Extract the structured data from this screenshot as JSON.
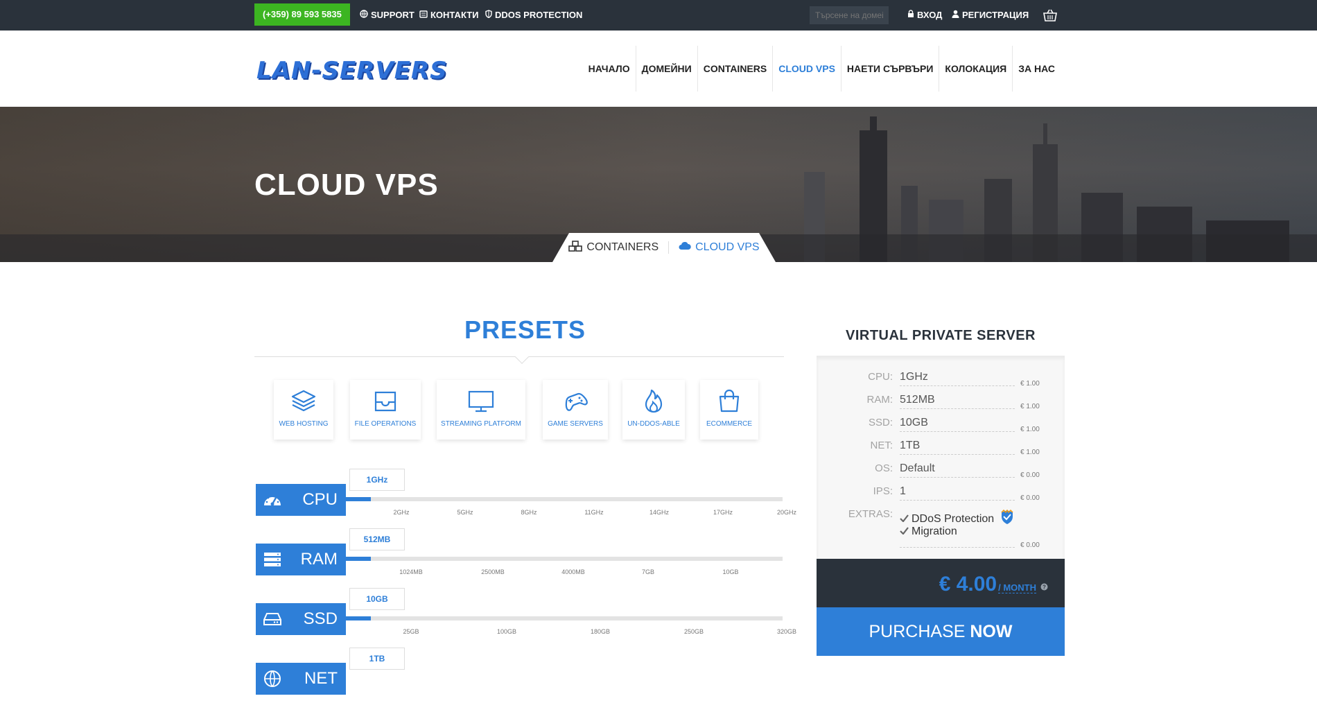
{
  "topbar": {
    "phone": "(+359) 89 593 5835",
    "links": [
      {
        "label": "SUPPORT",
        "icon": "globe-icon"
      },
      {
        "label": "КОНТАКТИ",
        "icon": "contact-icon"
      },
      {
        "label": "DDOS PROTECTION",
        "icon": "shield-icon"
      }
    ],
    "search_placeholder": "Търсене на домейн",
    "login": "ВХОД",
    "register": "РЕГИСТРАЦИЯ",
    "cart_icon": "basket-icon"
  },
  "logo": "LAN-SERVERS",
  "nav": [
    {
      "label": "НАЧАЛО",
      "active": false
    },
    {
      "label": "ДОМЕЙНИ",
      "active": false
    },
    {
      "label": "CONTAINERS",
      "active": false
    },
    {
      "label": "CLOUD VPS",
      "active": true
    },
    {
      "label": "НАЕТИ СЪРВЪРИ",
      "active": false
    },
    {
      "label": "КОЛОКАЦИЯ",
      "active": false
    },
    {
      "label": "ЗА НАС",
      "active": false
    }
  ],
  "hero": {
    "title": "CLOUD VPS",
    "tabs": [
      {
        "label": "CONTAINERS",
        "icon": "cubes-icon",
        "active": false
      },
      {
        "label": "CLOUD VPS",
        "icon": "cloud-icon",
        "active": true
      }
    ]
  },
  "presets": {
    "title": "PRESETS",
    "items": [
      {
        "label": "WEB HOSTING",
        "icon": "layers-icon"
      },
      {
        "label": "FILE OPERATIONS",
        "icon": "inbox-icon"
      },
      {
        "label": "STREAMING PLATFORM",
        "icon": "monitor-icon"
      },
      {
        "label": "GAME SERVERS",
        "icon": "gamepad-icon"
      },
      {
        "label": "UN-DDOS-ABLE",
        "icon": "flame-icon"
      },
      {
        "label": "ECOMMERCE",
        "icon": "shopping-bag-icon"
      }
    ]
  },
  "sliders": [
    {
      "name": "CPU",
      "icon": "speedometer-icon",
      "value": "1GHz",
      "fill_fraction": 0.057,
      "ticks": [
        "2GHz",
        "5GHz",
        "8GHz",
        "11GHz",
        "14GHz",
        "17GHz",
        "20GHz"
      ]
    },
    {
      "name": "RAM",
      "icon": "server-rack-icon",
      "value": "512MB",
      "fill_fraction": 0.057,
      "ticks": [
        "1024MB",
        "2500MB",
        "4000MB",
        "7GB",
        "10GB"
      ]
    },
    {
      "name": "SSD",
      "icon": "hard-drive-icon",
      "value": "10GB",
      "fill_fraction": 0.057,
      "ticks": [
        "25GB",
        "100GB",
        "180GB",
        "250GB",
        "320GB"
      ]
    },
    {
      "name": "NET",
      "icon": "globe-icon",
      "value": "1TB",
      "fill_fraction": 0.057,
      "ticks": []
    }
  ],
  "summary": {
    "title": "VIRTUAL PRIVATE SERVER",
    "specs": [
      {
        "key": "CPU:",
        "value": "1GHz",
        "price": "€ 1.00"
      },
      {
        "key": "RAM:",
        "value": "512MB",
        "price": "€ 1.00"
      },
      {
        "key": "SSD:",
        "value": "10GB",
        "price": "€ 1.00"
      },
      {
        "key": "NET:",
        "value": "1TB",
        "price": "€ 1.00"
      },
      {
        "key": "OS:",
        "value": "Default",
        "price": "€ 0.00"
      },
      {
        "key": "IPS:",
        "value": "1",
        "price": "€ 0.00"
      }
    ],
    "extras_key": "EXTRAS:",
    "extras": [
      "DDoS Protection",
      "Migration"
    ],
    "extras_price": "€ 0.00",
    "total": "€ 4.00",
    "period": "/ MONTH",
    "purchase_a": "PURCHASE ",
    "purchase_b": "NOW"
  },
  "colors": {
    "accent": "#2e7fd8",
    "topbar": "#2a323b",
    "phone_bg": "#3cb521"
  }
}
